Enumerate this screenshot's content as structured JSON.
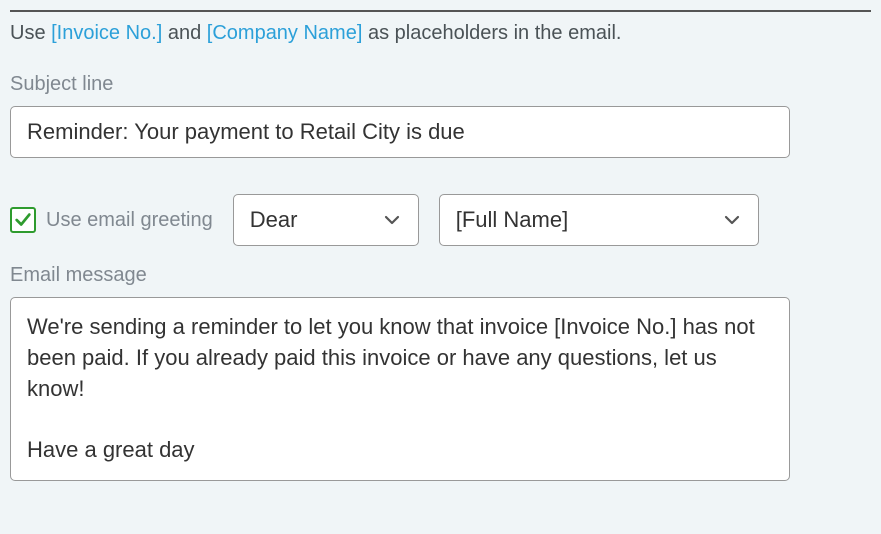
{
  "hint": {
    "prefix": "Use ",
    "placeholder1": "[Invoice No.]",
    "mid": " and ",
    "placeholder2": "[Company Name]",
    "suffix": " as placeholders in the email."
  },
  "subject": {
    "label": "Subject line",
    "value": "Reminder: Your payment to Retail City is due"
  },
  "greeting": {
    "checkbox_label": "Use email greeting",
    "checked": true,
    "salutation": "Dear",
    "name_token": "[Full Name]"
  },
  "message": {
    "label": "Email message",
    "value": "We're sending a reminder to let you know that invoice [Invoice No.] has not been paid. If you already paid this invoice or have any questions, let us know!\n\nHave a great day"
  }
}
